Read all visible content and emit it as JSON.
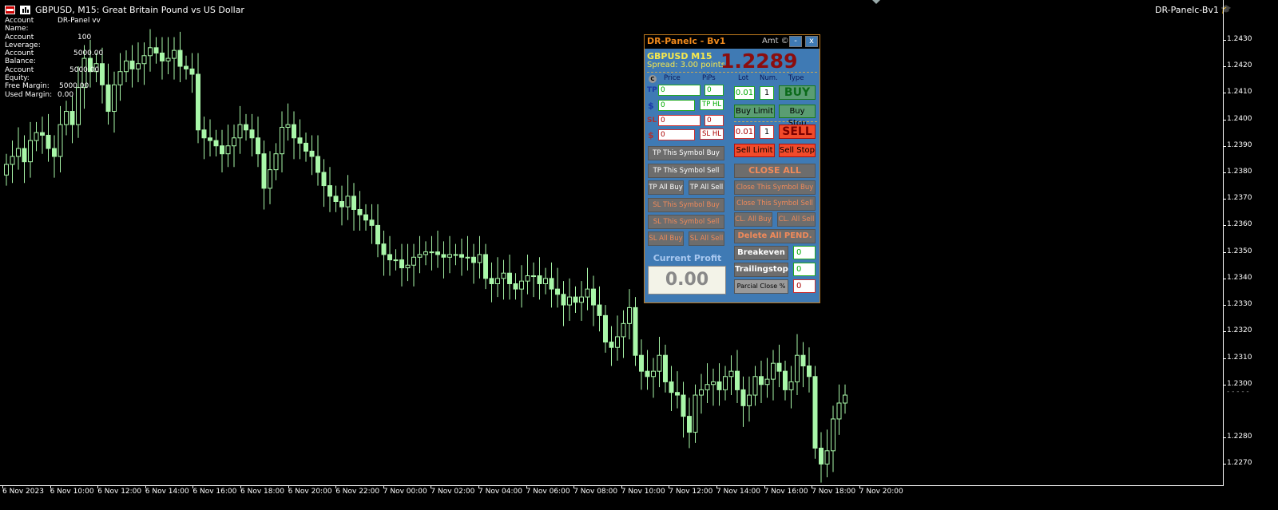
{
  "window": {
    "title": "GBPUSD, M15:  Great Britain Pound vs US Dollar",
    "ea_name": "DR-Panelc-Bv1"
  },
  "account": [
    {
      "key": "Account Name:",
      "value": "DR-Panel vv"
    },
    {
      "key": "Account Leverage:",
      "value": "100"
    },
    {
      "key": "Account Balance:",
      "value": "5000.00"
    },
    {
      "key": "Account Equity:",
      "value": "5000.00"
    },
    {
      "key": "Free Margin:",
      "value": "5000.00"
    },
    {
      "key": "Used Margin:",
      "value": "0.00"
    }
  ],
  "price_axis": [
    "1.2430",
    "1.2420",
    "1.2410",
    "1.2400",
    "1.2390",
    "1.2380",
    "1.2370",
    "1.2360",
    "1.2350",
    "1.2340",
    "1.2330",
    "1.2320",
    "1.2310",
    "1.2300",
    "1.2280",
    "1.2270"
  ],
  "time_axis": [
    "6 Nov 2023",
    "6 Nov 10:00",
    "6 Nov 12:00",
    "6 Nov 14:00",
    "6 Nov 16:00",
    "6 Nov 18:00",
    "6 Nov 20:00",
    "6 Nov 22:00",
    "7 Nov 00:00",
    "7 Nov 02:00",
    "7 Nov 04:00",
    "7 Nov 06:00",
    "7 Nov 08:00",
    "7 Nov 10:00",
    "7 Nov 12:00",
    "7 Nov 14:00",
    "7 Nov 16:00",
    "7 Nov 18:00",
    "7 Nov 20:00"
  ],
  "chart_data": {
    "type": "candlestick",
    "symbol": "GBPUSD",
    "timeframe": "M15",
    "ylim": [
      1.2262,
      1.2445
    ],
    "candle_color": "#a9f7a9",
    "closes": [
      1.2383,
      1.2386,
      1.2389,
      1.2384,
      1.2392,
      1.2395,
      1.2394,
      1.2389,
      1.2386,
      1.2398,
      1.2403,
      1.2398,
      1.2412,
      1.2423,
      1.2418,
      1.2421,
      1.2413,
      1.2403,
      1.2413,
      1.2418,
      1.2422,
      1.2419,
      1.2421,
      1.2424,
      1.2427,
      1.2425,
      1.2422,
      1.2423,
      1.2426,
      1.242,
      1.2419,
      1.2417,
      1.2396,
      1.2393,
      1.2392,
      1.239,
      1.2387,
      1.239,
      1.2393,
      1.2398,
      1.2396,
      1.2393,
      1.2387,
      1.2374,
      1.2381,
      1.2387,
      1.2397,
      1.2398,
      1.2393,
      1.2391,
      1.2388,
      1.2386,
      1.238,
      1.2375,
      1.2371,
      1.2369,
      1.2367,
      1.2371,
      1.2366,
      1.2364,
      1.2362,
      1.236,
      1.2353,
      1.2349,
      1.2347,
      1.2347,
      1.2344,
      1.2345,
      1.2348,
      1.2349,
      1.235,
      1.235,
      1.2349,
      1.2348,
      1.2349,
      1.2349,
      1.2348,
      1.2348,
      1.2346,
      1.2349,
      1.234,
      1.2338,
      1.234,
      1.2342,
      1.2338,
      1.2336,
      1.2339,
      1.2341,
      1.2341,
      1.2338,
      1.234,
      1.2336,
      1.2334,
      1.233,
      1.2333,
      1.2331,
      1.2333,
      1.2336,
      1.233,
      1.2326,
      1.2316,
      1.2314,
      1.2318,
      1.2323,
      1.2329,
      1.2311,
      1.2305,
      1.2303,
      1.2305,
      1.2311,
      1.2301,
      1.2297,
      1.2296,
      1.2288,
      1.2282,
      1.2296,
      1.2298,
      1.23,
      1.2301,
      1.2298,
      1.2303,
      1.2305,
      1.2298,
      1.2292,
      1.2296,
      1.2303,
      1.23,
      1.2302,
      1.2308,
      1.2305,
      1.2298,
      1.2301,
      1.2311,
      1.2307,
      1.2303,
      1.2276,
      1.227,
      1.2275,
      1.2287,
      1.2293,
      1.2296
    ],
    "last_price": 1.2297
  },
  "panel": {
    "title": "DR-Panelc - Bv1",
    "amt_label": "Amt ©",
    "min_label": "-",
    "close_label": "x",
    "symbol_line": "GBPUSD  M15",
    "spread_line": "Spread: 3.00 points",
    "big_price": "1.2289",
    "c_badge": "C",
    "col_price": "Price",
    "col_pips": "PiPs",
    "col_lot": "Lot",
    "col_num": "Num.",
    "col_type": "Type",
    "tp_label": "TP",
    "sl_label": "SL",
    "dollar": "$",
    "tp_price": "0",
    "tp_pips": "0",
    "tp_dollar": "0",
    "tp_hl": "TP HL",
    "sl_price": "0",
    "sl_pips": "0",
    "sl_dollar": "0",
    "sl_hl": "SL HL",
    "buy_lot": "0.01",
    "buy_num": "1",
    "buy": "BUY",
    "buy_limit": "Buy Limit",
    "buy_stop": "Buy Stop",
    "sell_lot": "0.01",
    "sell_num": "1",
    "sell": "SELL",
    "sell_limit": "Sell Limit",
    "sell_stop": "Sell Stop",
    "tp_this_buy": "TP This Symbol Buy",
    "tp_this_sell": "TP This Symbol Sell",
    "tp_all_buy": "TP All Buy",
    "tp_all_sell": "TP All Sell",
    "sl_this_buy": "SL This Symbol Buy",
    "sl_this_sell": "SL This Symbol Sell",
    "sl_all_buy": "SL All Buy",
    "sl_all_sell": "SL All Sell",
    "close_all": "CLOSE  ALL",
    "close_this_buy": "Close This Symbol Buy",
    "close_this_sell": "Close This Symbol Sell",
    "cl_all_buy": "CL. All Buy",
    "cl_all_sell": "CL. All Sell",
    "delete_pend": "Delete All PEND.",
    "breakeven": "Breakeven",
    "breakeven_val": "0",
    "trailingstop": "Trailingstop",
    "trailingstop_val": "0",
    "partial_close": "Parcial Close %",
    "partial_close_val": "0",
    "current_profit_label": "Current Profit",
    "current_profit": "0.00"
  }
}
